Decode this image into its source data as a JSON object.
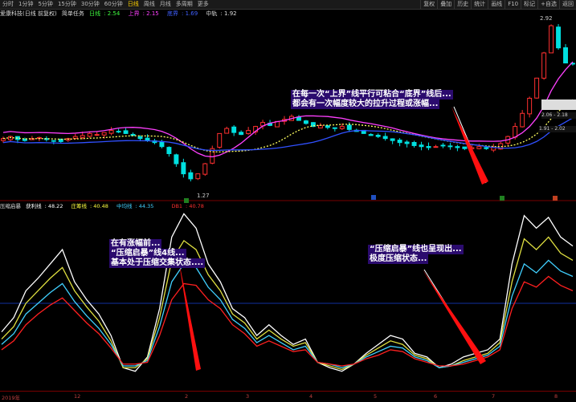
{
  "toolbar": {
    "items": [
      "分时",
      "1分钟",
      "5分钟",
      "15分钟",
      "30分钟",
      "60分钟",
      "日线",
      "周线",
      "月线",
      "多周期",
      "更多"
    ],
    "active_index": 6,
    "right": [
      "复权",
      "叠加",
      "历史",
      "统计",
      "画线",
      "F10",
      "标记",
      "+自选",
      "返回"
    ]
  },
  "info": {
    "stock": "爱康科技(日线 前复权)",
    "indicator_name": "简单任务",
    "rixian_label": "日线",
    "rixian_value": "2.54",
    "shangjie_label": "上界",
    "shangjie_value": "2.15",
    "dijie_label": "底界",
    "dijie_value": "1.69",
    "zhongzhou_label": "中轨",
    "zhongzhou_value": "1.92"
  },
  "price_labels": {
    "high": "2.92",
    "low": "1.27",
    "range_box": "2.06 - 2.18",
    "range_box2": "1.91 - 2.02"
  },
  "indicator": {
    "title": "压缩启暴",
    "items": [
      {
        "label": "获利线",
        "value": "48.22",
        "color": "#ffffff"
      },
      {
        "label": "庄筹线",
        "value": "40.48",
        "color": "#ffff40"
      },
      {
        "label": "中均线",
        "value": "44.35",
        "color": "#40d0ff"
      },
      {
        "label": "",
        "value": "",
        "color": "#0080ff"
      },
      {
        "label": "DB1",
        "value": "40.78",
        "color": "#ff3030"
      }
    ]
  },
  "annotations": {
    "top": [
      "在每一次“上界”线平行可粘合“底界”线后...",
      "都会有一次幅度较大的拉升过程或涨幅..."
    ],
    "left": [
      "在有涨幅前...",
      "“压缩启暴”线4线...",
      "基本处于压缩交集状态...."
    ],
    "right": [
      "“压缩启暴”线也呈现出...",
      "极度压缩状态..."
    ]
  },
  "xaxis": {
    "labels": [
      "2019年",
      "12",
      "2",
      "3",
      "4",
      "5",
      "6",
      "7",
      "8"
    ]
  },
  "colors": {
    "up": "#ff3030",
    "down": "#00e0e0",
    "magenta": "#ff40ff",
    "blue": "#3050ff",
    "yellow_dotted": "#ffff60"
  },
  "chart_data": {
    "type": "line",
    "price_closes": [
      1.8,
      1.82,
      1.79,
      1.78,
      1.8,
      1.81,
      1.79,
      1.78,
      1.77,
      1.8,
      1.82,
      1.83,
      1.85,
      1.84,
      1.86,
      1.88,
      1.87,
      1.85,
      1.83,
      1.8,
      1.78,
      1.76,
      1.72,
      1.65,
      1.55,
      1.45,
      1.4,
      1.45,
      1.55,
      1.7,
      1.85,
      1.9,
      1.86,
      1.84,
      1.88,
      1.92,
      1.96,
      1.93,
      1.97,
      1.99,
      2.02,
      1.98,
      1.95,
      1.92,
      1.93,
      1.91,
      1.9,
      1.92,
      1.89,
      1.87,
      1.85,
      1.83,
      1.82,
      1.8,
      1.78,
      1.76,
      1.75,
      1.73,
      1.72,
      1.71,
      1.72,
      1.73,
      1.72,
      1.71,
      1.7,
      1.71,
      1.72,
      1.7,
      1.71,
      1.75,
      1.82,
      1.92,
      2.05,
      2.2,
      2.4,
      2.65,
      2.92,
      2.7,
      2.55,
      2.54
    ],
    "indicator_series": {
      "white": [
        32,
        40,
        55,
        62,
        70,
        78,
        60,
        50,
        42,
        30,
        12,
        10,
        18,
        45,
        85,
        98,
        90,
        70,
        60,
        45,
        40,
        30,
        36,
        30,
        25,
        28,
        15,
        12,
        10,
        14,
        20,
        25,
        30,
        28,
        20,
        18,
        12,
        14,
        18,
        20,
        22,
        28,
        70,
        97,
        90,
        96,
        85,
        80
      ],
      "yellow": [
        28,
        35,
        48,
        55,
        62,
        68,
        55,
        46,
        38,
        27,
        12,
        12,
        17,
        40,
        72,
        83,
        78,
        64,
        55,
        42,
        37,
        28,
        33,
        28,
        24,
        26,
        15,
        13,
        11,
        14,
        19,
        23,
        27,
        25,
        19,
        17,
        12,
        13,
        16,
        18,
        20,
        26,
        60,
        84,
        78,
        85,
        76,
        72
      ],
      "cyan": [
        25,
        31,
        42,
        48,
        54,
        59,
        49,
        41,
        34,
        25,
        13,
        13,
        16,
        35,
        60,
        70,
        68,
        57,
        50,
        39,
        34,
        26,
        30,
        26,
        22,
        24,
        15,
        14,
        12,
        14,
        18,
        21,
        24,
        23,
        18,
        16,
        12,
        13,
        15,
        17,
        19,
        24,
        52,
        70,
        65,
        72,
        66,
        63
      ],
      "red": [
        22,
        27,
        36,
        42,
        47,
        51,
        44,
        37,
        31,
        23,
        14,
        14,
        15,
        30,
        50,
        59,
        58,
        50,
        45,
        36,
        31,
        24,
        27,
        24,
        21,
        22,
        15,
        14,
        13,
        14,
        17,
        19,
        22,
        21,
        17,
        15,
        13,
        13,
        14,
        16,
        18,
        22,
        45,
        60,
        57,
        63,
        58,
        55
      ]
    }
  }
}
